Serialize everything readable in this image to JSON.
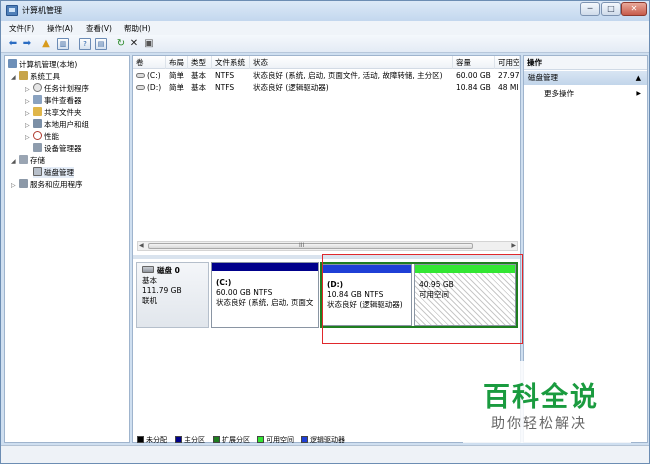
{
  "window": {
    "title": "计算机管理",
    "min": "─",
    "max": "□",
    "close": "✕"
  },
  "menu": [
    "文件(F)",
    "操作(A)",
    "查看(V)",
    "帮助(H)"
  ],
  "tree": [
    {
      "label": "计算机管理(本地)"
    },
    {
      "label": "系统工具"
    },
    {
      "label": "任务计划程序"
    },
    {
      "label": "事件查看器"
    },
    {
      "label": "共享文件夹"
    },
    {
      "label": "本地用户和组"
    },
    {
      "label": "性能"
    },
    {
      "label": "设备管理器"
    },
    {
      "label": "存储"
    },
    {
      "label": "磁盘管理"
    },
    {
      "label": "服务和应用程序"
    }
  ],
  "volume_columns": [
    "卷",
    "布局",
    "类型",
    "文件系统",
    "状态",
    "容量",
    "可用空"
  ],
  "volumes": [
    {
      "vol": "(C:)",
      "layout": "简单",
      "type": "基本",
      "fs": "NTFS",
      "status": "状态良好 (系统, 启动, 页面文件, 活动, 故障转储, 主分区)",
      "capacity": "60.00 GB",
      "free": "27.97"
    },
    {
      "vol": "(D:)",
      "layout": "简单",
      "type": "基本",
      "fs": "NTFS",
      "status": "状态良好 (逻辑驱动器)",
      "capacity": "10.84 GB",
      "free": "48 MI"
    }
  ],
  "scroll_grip": "III",
  "disk": {
    "name": "磁盘 0",
    "type": "基本",
    "size": "111.79 GB",
    "state": "联机"
  },
  "partitions": [
    {
      "name": "(C:)",
      "size": "60.00 GB NTFS",
      "status": "状态良好 (系统, 启动, 页面文"
    },
    {
      "name": "(D:)",
      "size": "10.84 GB NTFS",
      "status": "状态良好 (逻辑驱动器)"
    },
    {
      "name": "",
      "size": "40.95 GB",
      "status": "可用空间"
    }
  ],
  "legend": [
    {
      "label": "未分配",
      "color": "#000000"
    },
    {
      "label": "主分区",
      "color": "#00008b"
    },
    {
      "label": "扩展分区",
      "color": "#1f7d1f"
    },
    {
      "label": "可用空间",
      "color": "#33e633"
    },
    {
      "label": "逻辑驱动器",
      "color": "#1f3fd6"
    }
  ],
  "actions": {
    "title": "操作",
    "section": "磁盘管理",
    "more": "更多操作"
  },
  "watermark": {
    "main": "百科全说",
    "sub": "助你轻松解决"
  },
  "colors": {
    "primary": "#00008b",
    "logical": "#1f3fd6",
    "free": "#33e633",
    "extended": "#1f7d1f",
    "highlight": "#e0282c",
    "brand": "#1a9b3f"
  }
}
